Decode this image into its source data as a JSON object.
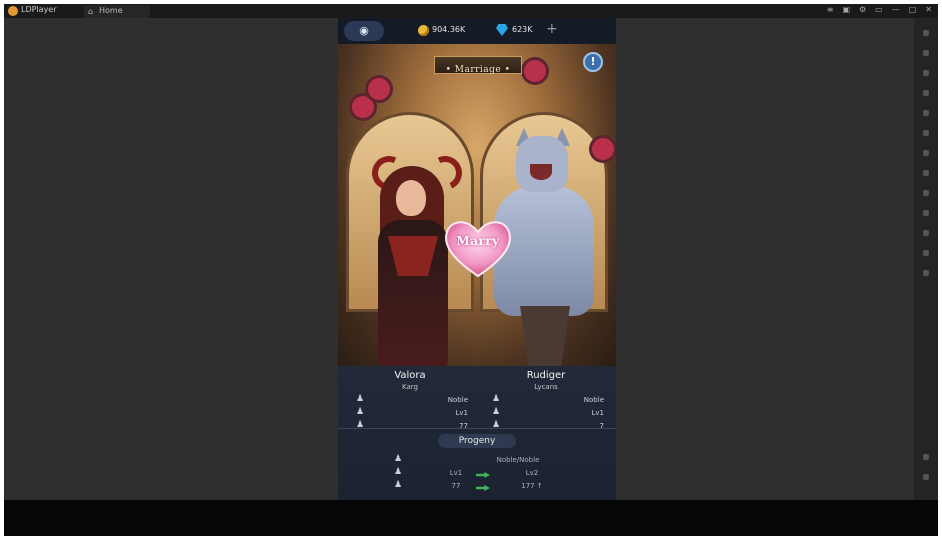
{
  "window": {
    "app_name": "LDPlayer",
    "home_tab_label": "Home",
    "home_icon": "home-icon",
    "titlebar_icons": [
      "menu-icon",
      "lock-icon",
      "settings-icon",
      "restore-icon",
      "minimize-icon",
      "maximize-icon",
      "close-icon"
    ]
  },
  "topbar": {
    "eye_icon": "eye-icon",
    "gold_value": "904.36K",
    "gem_value": "623K",
    "plus_label": "+"
  },
  "banner": {
    "title": "• Marriage •"
  },
  "info_button": {
    "label": "!"
  },
  "heart_button": {
    "label": "Marry"
  },
  "left_character": {
    "name": "Valora",
    "race": "Karg",
    "stats": [
      "Noble",
      "Lv1",
      "77"
    ]
  },
  "right_character": {
    "name": "Rudiger",
    "race": "Lycans",
    "stats": [
      "Noble",
      "Lv1",
      "7"
    ]
  },
  "progeny": {
    "title": "Progeny",
    "rows": [
      {
        "left": "",
        "right": "Noble/Noble"
      },
      {
        "left": "Lv1",
        "right": "Lv2"
      },
      {
        "left": "77",
        "right": "177 ↑"
      }
    ]
  },
  "colors": {
    "accent_gold": "#e8b83a",
    "gem_blue": "#2ea4e8",
    "heart_pink": "#f29bc6",
    "arrow_green": "#44b05a"
  }
}
